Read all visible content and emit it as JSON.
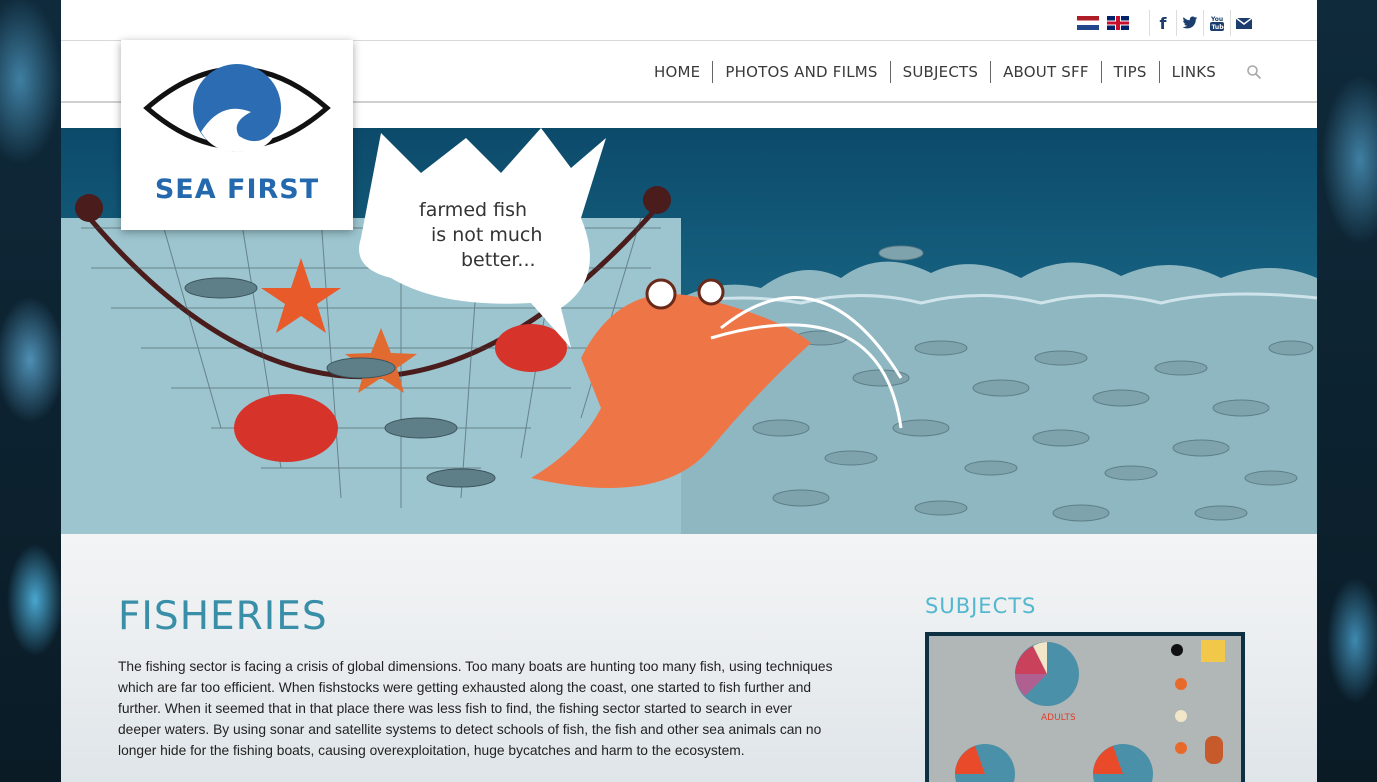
{
  "header": {
    "flags": [
      {
        "name": "dutch-flag"
      },
      {
        "name": "uk-flag"
      }
    ],
    "social": [
      {
        "name": "facebook-icon",
        "glyph": "f"
      },
      {
        "name": "twitter-icon",
        "glyph": "t"
      },
      {
        "name": "youtube-icon",
        "glyph": "You Tube"
      },
      {
        "name": "mail-icon",
        "glyph": "✉"
      }
    ],
    "nav": [
      {
        "label": "HOME"
      },
      {
        "label": "PHOTOS AND FILMS"
      },
      {
        "label": "SUBJECTS"
      },
      {
        "label": "ABOUT SFF"
      },
      {
        "label": "TIPS"
      },
      {
        "label": "LINKS"
      }
    ],
    "search_icon": "search-icon"
  },
  "logo": {
    "text": "SEA FIRST"
  },
  "hero": {
    "bubble": [
      "farmed fish",
      "is not much",
      "better..."
    ]
  },
  "main": {
    "title": "FISHERIES",
    "body": "The fishing sector is facing a crisis of global dimensions. Too many boats are hunting too many fish, using techniques which are far too efficient. When fishstocks were getting exhausted along the coast, one started to fish further and further. When it seemed that in that place there was less fish to find, the fishing sector started to search in ever deeper waters. By using sonar and satellite systems to detect schools of fish, the fish and other sea animals can no longer hide for the fishing boats, causing overexploitation, huge bycatches and harm to the ecosystem."
  },
  "sidebar": {
    "title": "SUBJECTS",
    "image_label": "ADULTS"
  },
  "colors": {
    "brand_blue": "#2468ad",
    "heading_teal": "#3a8fa8",
    "subjects_teal": "#52b7cf"
  }
}
